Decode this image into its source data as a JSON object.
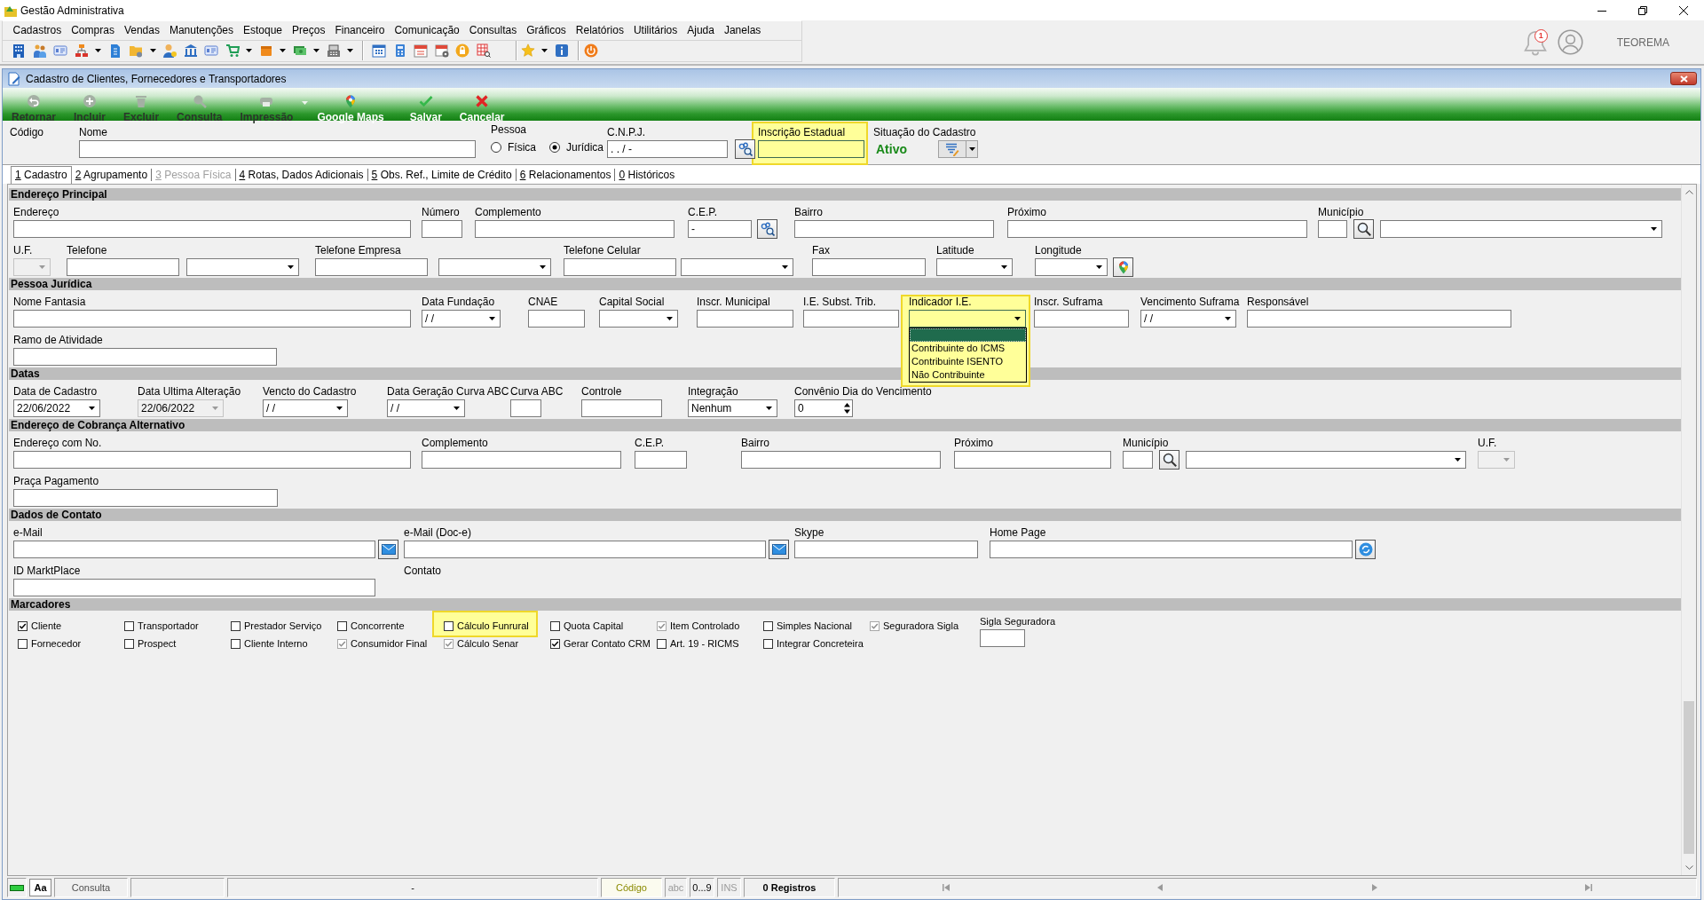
{
  "app": {
    "title": "Gestão Administrativa",
    "notification_count": "1",
    "user": "TEOREMA"
  },
  "menu": [
    "Cadastros",
    "Compras",
    "Vendas",
    "Manutenções",
    "Estoque",
    "Preços",
    "Financeiro",
    "Comunicação",
    "Consultas",
    "Gráficos",
    "Relatórios",
    "Utilitários",
    "Ajuda",
    "Janelas"
  ],
  "window": {
    "title": "Cadastro de Clientes, Fornecedores e Transportadores"
  },
  "actions": [
    {
      "label": "Retornar",
      "disabled": true
    },
    {
      "label": "Incluir",
      "disabled": true
    },
    {
      "label": "Excluir",
      "disabled": true
    },
    {
      "label": "Consulta",
      "disabled": true
    },
    {
      "label": "Impressão",
      "disabled": true
    },
    {
      "label": "Google Maps",
      "disabled": false
    },
    {
      "label": "Salvar",
      "disabled": false
    },
    {
      "label": "Cancelar",
      "disabled": false
    }
  ],
  "header": {
    "codigo": {
      "label": "Código"
    },
    "nome": {
      "label": "Nome"
    },
    "pessoa": {
      "label": "Pessoa",
      "options": [
        {
          "label": "Física",
          "selected": false
        },
        {
          "label": "Jurídica",
          "selected": true
        }
      ]
    },
    "cnpj": {
      "label": "C.N.P.J.",
      "value": ". . / -"
    },
    "inscricao_estadual": {
      "label": "Inscrição Estadual",
      "highlighted": true
    },
    "situacao": {
      "label": "Situação do Cadastro",
      "value": "Ativo"
    }
  },
  "tabs": [
    {
      "label": "1 Cadastro",
      "selected": true,
      "disabled": false
    },
    {
      "label": "2 Agrupamento",
      "selected": false,
      "disabled": false
    },
    {
      "label": "3 Pessoa Física",
      "selected": false,
      "disabled": true
    },
    {
      "label": "4 Rotas, Dados Adicionais",
      "selected": false,
      "disabled": false
    },
    {
      "label": "5 Obs. Ref., Limite de Crédito",
      "selected": false,
      "disabled": false
    },
    {
      "label": "6 Relacionamentos",
      "selected": false,
      "disabled": false
    },
    {
      "label": "0 Históricos",
      "selected": false,
      "disabled": false
    }
  ],
  "sections": [
    {
      "title": "Endereço Principal",
      "rows": [
        [
          {
            "kind": "text",
            "label": "Endereço",
            "disabled": false,
            "highlighted": false
          },
          {
            "kind": "text",
            "label": "Número",
            "disabled": false,
            "highlighted": false
          },
          {
            "kind": "text",
            "label": "Complemento",
            "disabled": false,
            "highlighted": false
          },
          {
            "kind": "text_lookup",
            "label": "C.E.P.",
            "value": "-",
            "disabled": false,
            "highlighted": false
          },
          {
            "kind": "text",
            "label": "Bairro",
            "disabled": false,
            "highlighted": false
          },
          {
            "kind": "text",
            "label": "Próximo",
            "disabled": false,
            "highlighted": false
          },
          {
            "kind": "code_combo",
            "label": "Município",
            "disabled": false,
            "highlighted": false
          }
        ],
        [
          {
            "kind": "combo",
            "label": "U.F.",
            "disabled": true,
            "highlighted": false
          },
          {
            "kind": "text",
            "label": "Telefone",
            "disabled": false,
            "highlighted": false
          },
          {
            "kind": "combo",
            "disabled": false,
            "highlighted": false
          },
          {
            "kind": "text",
            "label": "Telefone Empresa",
            "disabled": false,
            "highlighted": false
          },
          {
            "kind": "combo",
            "disabled": false,
            "highlighted": false
          },
          {
            "kind": "text",
            "label": "Telefone Celular",
            "disabled": false,
            "highlighted": false
          },
          {
            "kind": "combo",
            "disabled": false,
            "highlighted": false
          },
          {
            "kind": "text",
            "label": "Fax",
            "disabled": false,
            "highlighted": false
          },
          {
            "kind": "combo",
            "label": "Latitude",
            "disabled": false,
            "highlighted": false
          },
          {
            "kind": "combo_map",
            "label": "Longitude",
            "disabled": false,
            "highlighted": false
          }
        ]
      ]
    },
    {
      "title": "Pessoa Jurídica",
      "rows": [
        [
          {
            "kind": "text",
            "label": "Nome Fantasia",
            "disabled": false,
            "highlighted": false
          },
          {
            "kind": "combo",
            "label": "Data Fundação",
            "value": "/ /",
            "disabled": false,
            "highlighted": false
          },
          {
            "kind": "text",
            "label": "CNAE",
            "disabled": false,
            "highlighted": false
          },
          {
            "kind": "combo",
            "label": "Capital Social",
            "disabled": false,
            "highlighted": false
          },
          {
            "kind": "text",
            "label": "Inscr. Municipal",
            "disabled": false,
            "highlighted": false
          },
          {
            "kind": "text",
            "label": "I.E. Subst. Trib.",
            "disabled": false,
            "highlighted": false
          },
          {
            "kind": "combo",
            "label": "Indicador I.E.",
            "disabled": false,
            "highlighted": true,
            "options": [
              {
                "selected": true
              },
              {
                "label": "Contribuinte do ICMS",
                "selected": false
              },
              {
                "label": "Contribuinte ISENTO",
                "selected": false
              },
              {
                "label": "Não Contribuinte",
                "selected": false
              }
            ]
          },
          {
            "kind": "text",
            "label": "Inscr. Suframa",
            "disabled": false,
            "highlighted": false
          },
          {
            "kind": "combo",
            "label": "Vencimento Suframa",
            "value": "/ /",
            "disabled": false,
            "highlighted": false
          },
          {
            "kind": "text",
            "label": "Responsável",
            "disabled": false,
            "highlighted": false
          }
        ],
        [
          {
            "kind": "text",
            "label": "Ramo de Atividade",
            "disabled": false,
            "highlighted": false
          }
        ]
      ]
    },
    {
      "title": "Datas",
      "rows": [
        [
          {
            "kind": "combo",
            "label": "Data de Cadastro",
            "value": "22/06/2022",
            "disabled": false,
            "highlighted": false
          },
          {
            "kind": "combo",
            "label": "Data Ultima Alteração",
            "value": "22/06/2022",
            "disabled": true,
            "highlighted": false
          },
          {
            "kind": "combo",
            "label": "Vencto do Cadastro",
            "value": "/ /",
            "disabled": false,
            "highlighted": false
          },
          {
            "kind": "combo",
            "label": "Data Geração Curva ABC",
            "value": "/ /",
            "disabled": false,
            "highlighted": false
          },
          {
            "kind": "text",
            "label": "Curva ABC",
            "disabled": false,
            "highlighted": false
          },
          {
            "kind": "text",
            "label": "Controle",
            "disabled": false,
            "highlighted": false
          },
          {
            "kind": "combo",
            "label": "Integração",
            "value": "Nenhum",
            "disabled": false,
            "highlighted": false
          },
          {
            "kind": "spin",
            "label": "Convênio Dia do Vencimento",
            "value": "0",
            "disabled": false,
            "highlighted": false
          }
        ]
      ]
    },
    {
      "title": "Endereço de Cobrança Alternativo",
      "rows": [
        [
          {
            "kind": "text",
            "label": "Endereço com No.",
            "disabled": false,
            "highlighted": false
          },
          {
            "kind": "text",
            "label": "Complemento",
            "disabled": false,
            "highlighted": false
          },
          {
            "kind": "text",
            "label": "C.E.P.",
            "disabled": false,
            "highlighted": false
          },
          {
            "kind": "text",
            "label": "Bairro",
            "disabled": false,
            "highlighted": false
          },
          {
            "kind": "text",
            "label": "Próximo",
            "disabled": false,
            "highlighted": false
          },
          {
            "kind": "code_combo",
            "label": "Município",
            "disabled": false,
            "highlighted": false
          },
          {
            "kind": "combo",
            "label": "U.F.",
            "disabled": true,
            "highlighted": false
          }
        ],
        [
          {
            "kind": "text",
            "label": "Praça Pagamento",
            "disabled": false,
            "highlighted": false
          }
        ]
      ]
    },
    {
      "title": "Dados de Contato",
      "rows": [
        [
          {
            "kind": "text_mail",
            "label": "e-Mail",
            "disabled": false,
            "highlighted": false
          },
          {
            "kind": "text_mail",
            "label": "e-Mail (Doc-e)",
            "disabled": false,
            "highlighted": false
          },
          {
            "kind": "text",
            "label": "Skype",
            "disabled": false,
            "highlighted": false
          },
          {
            "kind": "text_web",
            "label": "Home Page",
            "disabled": false,
            "highlighted": false
          }
        ],
        [
          {
            "kind": "text",
            "label": "ID MarktPlace",
            "disabled": false,
            "highlighted": false
          },
          {
            "kind": "label",
            "label": "Contato",
            "disabled": false,
            "highlighted": false
          }
        ]
      ]
    }
  ],
  "marcadores": {
    "title": "Marcadores",
    "checkboxes": [
      {
        "label": "Cliente",
        "checked": true,
        "disabled": false,
        "highlighted": false
      },
      {
        "label": "Transportador",
        "checked": false,
        "disabled": false,
        "highlighted": false
      },
      {
        "label": "Prestador Serviço",
        "checked": false,
        "disabled": false,
        "highlighted": false
      },
      {
        "label": "Concorrente",
        "checked": false,
        "disabled": false,
        "highlighted": false
      },
      {
        "label": "Cálculo Funrural",
        "checked": false,
        "disabled": false,
        "highlighted": true
      },
      {
        "label": "Quota Capital",
        "checked": false,
        "disabled": false,
        "highlighted": false
      },
      {
        "label": "Item Controlado",
        "checked": true,
        "disabled": true,
        "highlighted": false
      },
      {
        "label": "Simples Nacional",
        "checked": false,
        "disabled": false,
        "highlighted": false
      },
      {
        "label": "Seguradora Sigla",
        "checked": true,
        "disabled": true,
        "highlighted": false
      },
      {
        "label": "Fornecedor",
        "checked": false,
        "disabled": false,
        "highlighted": false
      },
      {
        "label": "Prospect",
        "checked": false,
        "disabled": false,
        "highlighted": false
      },
      {
        "label": "Cliente Interno",
        "checked": false,
        "disabled": false,
        "highlighted": false
      },
      {
        "label": "Consumidor Final",
        "checked": true,
        "disabled": true,
        "highlighted": false
      },
      {
        "label": "Cálculo Senar",
        "checked": true,
        "disabled": true,
        "highlighted": false
      },
      {
        "label": "Gerar Contato CRM",
        "checked": true,
        "disabled": false,
        "highlighted": false
      },
      {
        "label": "Art. 19 - RICMS",
        "checked": false,
        "disabled": false,
        "highlighted": false
      },
      {
        "label": "Integrar Concreteira",
        "checked": false,
        "disabled": false,
        "highlighted": false
      }
    ],
    "sigla_seguradora": {
      "label": "Sigla Seguradora"
    }
  },
  "status_bar": {
    "font_button": "Aa",
    "mode": "Consulta",
    "message": "-",
    "sort_field": "Código",
    "indicators": [
      {
        "label": "abc",
        "on": false
      },
      {
        "label": "0...9",
        "on": true
      },
      {
        "label": "INS",
        "on": false
      }
    ],
    "records": "0 Registros"
  }
}
